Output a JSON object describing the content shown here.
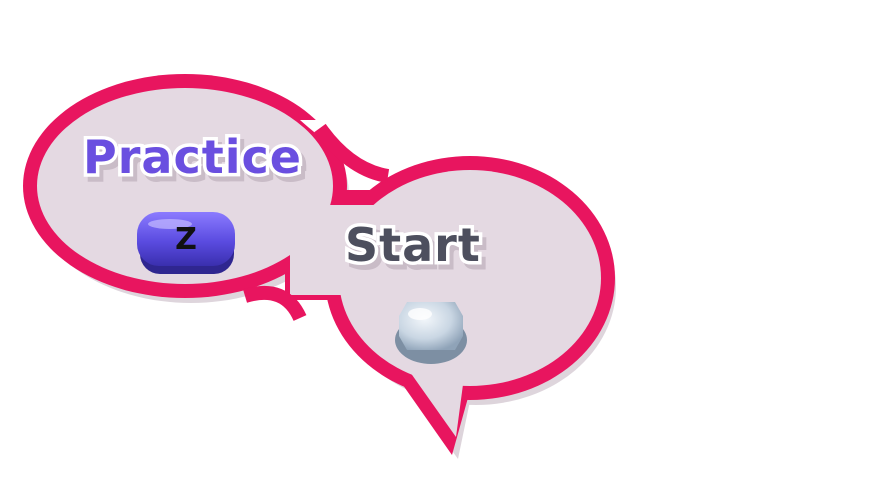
{
  "menu": {
    "practice": {
      "label": "Practice",
      "key": "Z",
      "color": "#6a4fe0"
    },
    "start": {
      "label": "Start",
      "button_icon": "round-silver-button-icon",
      "color": "#4d4f5e"
    }
  },
  "bubble": {
    "border_color": "#e8155f",
    "fill_color": "#e4d9e2"
  }
}
